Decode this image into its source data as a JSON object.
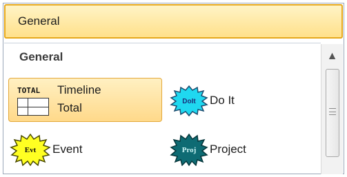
{
  "header": {
    "title": "General"
  },
  "section": {
    "title": "General"
  },
  "items": [
    {
      "label_line1": "Timeline",
      "label_line2": "Total",
      "icon_text": "TOTAL",
      "selected": true,
      "icon": "timeline-total-icon"
    },
    {
      "label": "Do It",
      "icon_text": "DoIt",
      "icon": "doit-starburst-icon",
      "color": "#1fd8f0"
    },
    {
      "label": "Event",
      "icon_text": "Evt",
      "icon": "event-starburst-icon",
      "color": "#ffff22"
    },
    {
      "label": "Project",
      "icon_text": "Proj",
      "icon": "project-starburst-icon",
      "color": "#0e6b73"
    }
  ],
  "scrollbar": {
    "up_arrow": "▲",
    "position": 0.0
  },
  "colors": {
    "header_border": "#e6a81c",
    "selected_bg": "#ffd98a"
  }
}
